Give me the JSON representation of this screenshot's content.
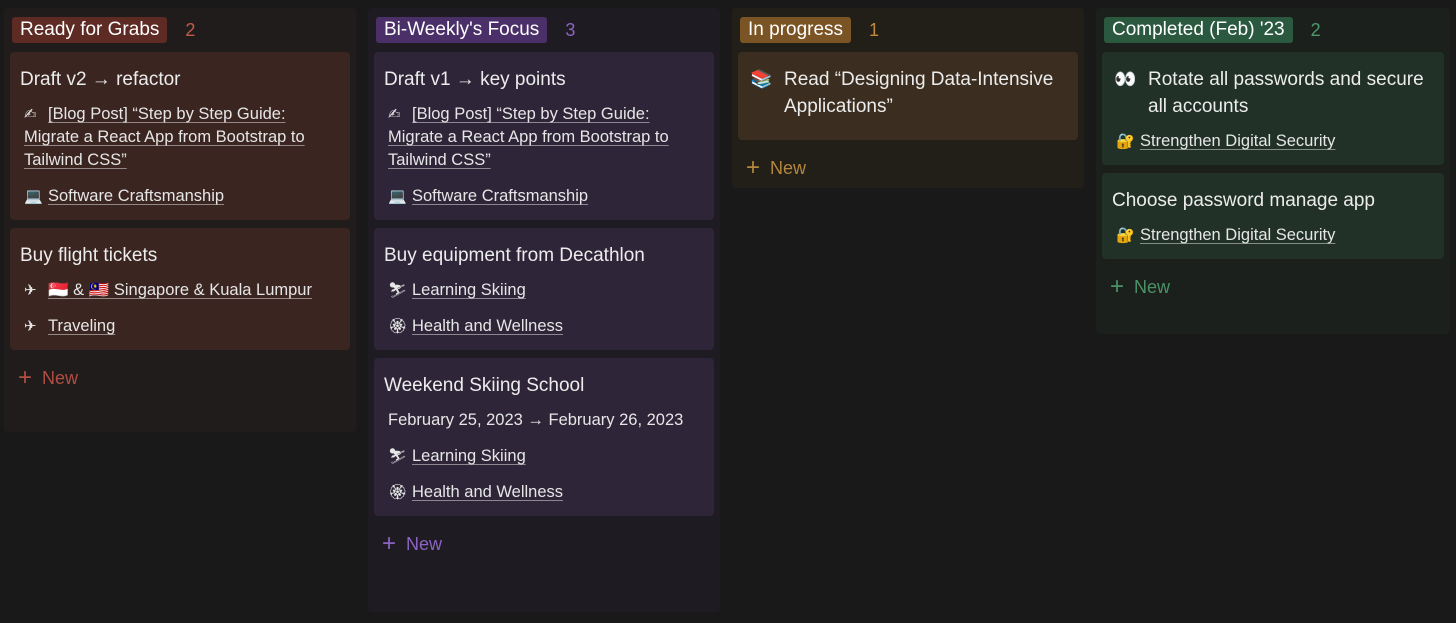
{
  "board": {
    "columns": [
      {
        "name": "Ready for Grabs",
        "count": "2",
        "new_label": "New",
        "cards": [
          {
            "title": "Draft v2 → refactor",
            "props": [
              {
                "emoji": "✍",
                "text": "[Blog Post] “Step by Step Guide: Migrate a React App from Bootstrap to Tailwind CSS”"
              },
              {
                "emoji": "💻",
                "text": "Software Craftsmanship"
              }
            ]
          },
          {
            "title": "Buy flight tickets",
            "props": [
              {
                "emoji": "✈",
                "text": "🇸🇬 & 🇲🇾 Singapore & Kuala Lumpur"
              },
              {
                "emoji": "✈",
                "text": "Traveling"
              }
            ]
          }
        ]
      },
      {
        "name": "Bi-Weekly's Focus",
        "count": "3",
        "new_label": "New",
        "cards": [
          {
            "title": "Draft v1 → key points",
            "props": [
              {
                "emoji": "✍",
                "text": "[Blog Post] “Step by Step Guide: Migrate a React App from Bootstrap to Tailwind CSS”"
              },
              {
                "emoji": "💻",
                "text": "Software Craftsmanship"
              }
            ]
          },
          {
            "title": "Buy equipment from Decathlon",
            "props": [
              {
                "emoji": "⛷",
                "text": "Learning Skiing"
              },
              {
                "emoji": "🏵",
                "text": "Health and Wellness"
              }
            ]
          },
          {
            "title": "Weekend Skiing School",
            "props": [
              {
                "emoji": "",
                "text": "February 25, 2023 → February 26, 2023"
              },
              {
                "emoji": "⛷",
                "text": "Learning Skiing"
              },
              {
                "emoji": "🏵",
                "text": "Health and Wellness"
              }
            ]
          }
        ]
      },
      {
        "name": "In progress",
        "count": "1",
        "new_label": "New",
        "cards": [
          {
            "title_emoji": "📚",
            "title": "Read “Designing Data-Intensive Applications”",
            "props": []
          }
        ]
      },
      {
        "name": "Completed (Feb) '23",
        "count": "2",
        "new_label": "New",
        "cards": [
          {
            "title_emoji": "👀",
            "title": "Rotate all passwords and secure all accounts",
            "props": [
              {
                "emoji": "🔐",
                "text": "Strengthen Digital Security"
              }
            ]
          },
          {
            "title": "Choose password manage app",
            "props": [
              {
                "emoji": "🔐",
                "text": "Strengthen Digital Security"
              }
            ]
          }
        ]
      }
    ]
  }
}
